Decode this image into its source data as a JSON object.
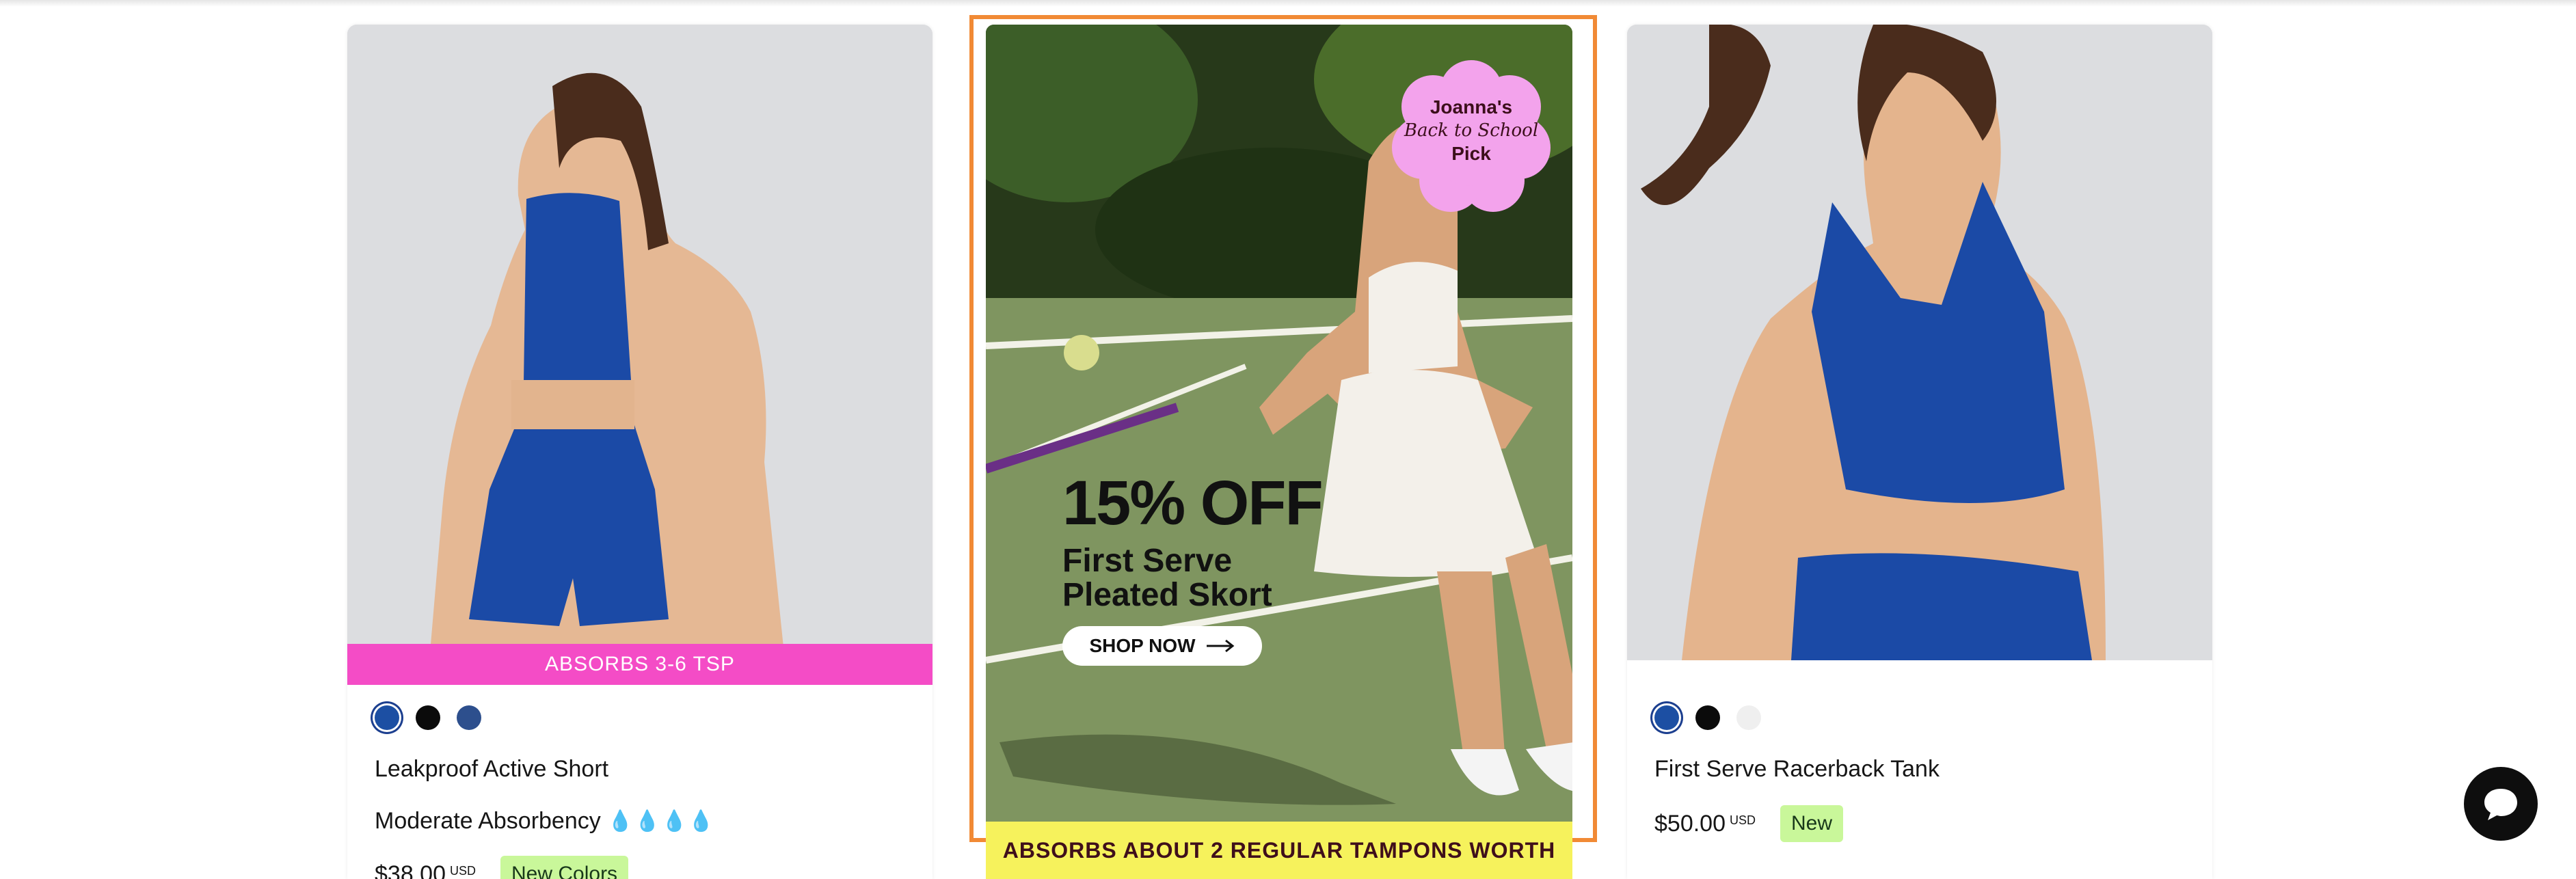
{
  "products": [
    {
      "badge": "ABSORBS 3-6 TSP",
      "swatches": [
        "#1c4fa3",
        "#0b0b0b",
        "#2d4f8d"
      ],
      "name": "Leakproof Active Short",
      "absorbency": "Moderate Absorbency",
      "drops": "💧💧💧💧",
      "price": "$38.00",
      "currency": "USD",
      "tag": "New Colors"
    },
    {
      "swatches": [
        "#1c4fa3",
        "#0b0b0b",
        "#efefef"
      ],
      "name": "First Serve Racerback Tank",
      "price": "$50.00",
      "currency": "USD",
      "tag": "New"
    }
  ],
  "promo": {
    "sticker_line1": "Joanna's",
    "sticker_line2": "Back to School",
    "sticker_line3": "Pick",
    "headline": "15% OFF",
    "product_line1": "First Serve",
    "product_line2": "Pleated Skort",
    "cta": "SHOP NOW",
    "bottom_bar": "ABSORBS ABOUT 2 REGULAR TAMPONS WORTH"
  },
  "chat": {
    "icon": "chat-bubble-icon"
  },
  "colors": {
    "badge_pink": "#f44cc6",
    "tag_green": "#c9f79a",
    "promo_outline": "#f18a35",
    "promo_bar_yellow": "#f6f25c",
    "sticker_pink": "#f3a3ec"
  }
}
